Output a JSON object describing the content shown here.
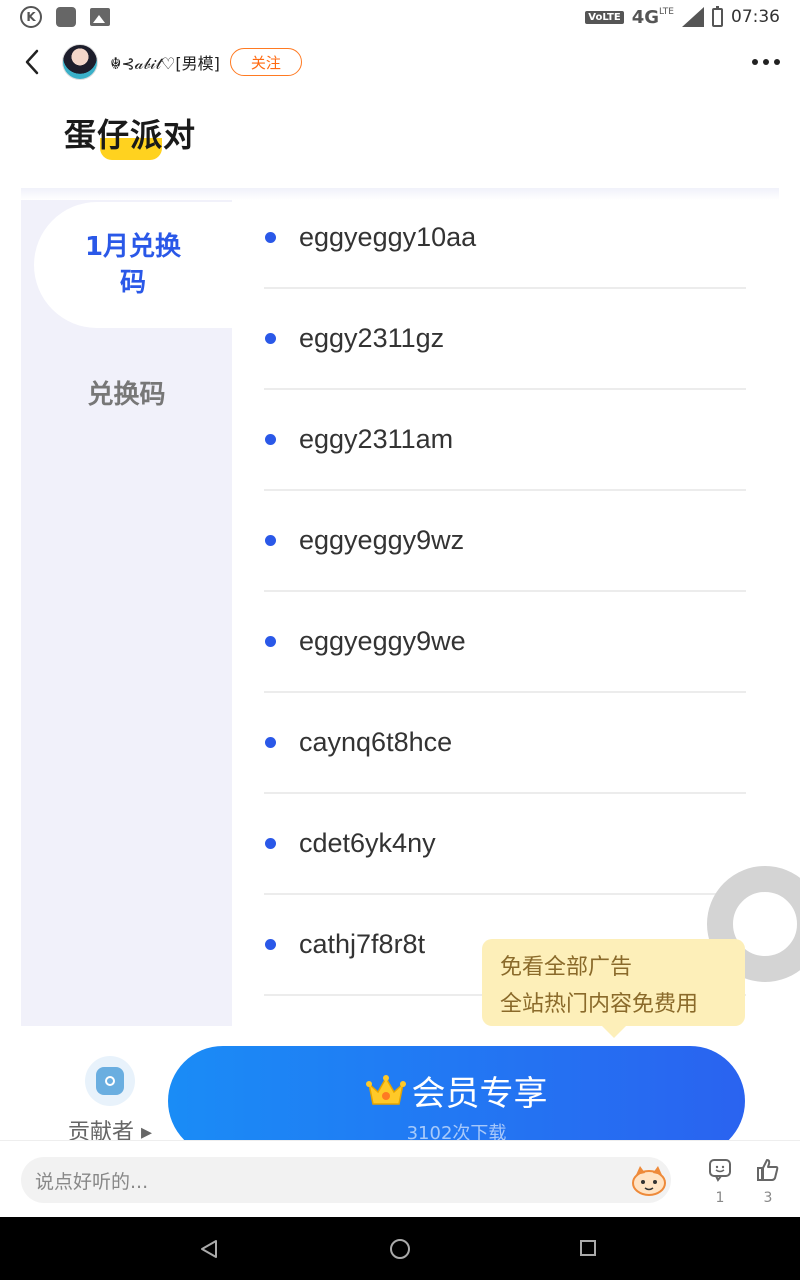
{
  "status_bar": {
    "network_volte": "VoLTE",
    "network_type": "4G",
    "network_lte": "LTE",
    "time": "07:36"
  },
  "header": {
    "username": "☬⊰𝒶𝒷𝒾𝓉♡[男模]",
    "follow_label": "关注"
  },
  "page": {
    "title": "蛋仔派对"
  },
  "sidebar": {
    "tabs": [
      {
        "label": "1月兑换码",
        "active": true
      },
      {
        "label": "兑换码",
        "active": false
      }
    ]
  },
  "codes": [
    "eggyeggy10aa",
    "eggy2311gz",
    "eggy2311am",
    "eggyeggy9wz",
    "eggyeggy9we",
    "caynq6t8hce",
    "cdet6yk4ny",
    "cathj7f8r8t"
  ],
  "tooltip": {
    "line1": "免看全部广告",
    "line2": "全站热门内容免费用"
  },
  "contributor": {
    "label": "贡献者 ▸"
  },
  "member_button": {
    "label": "会员专享",
    "downloads": "3102次下载"
  },
  "comment_bar": {
    "placeholder": "说点好听的...",
    "comment_count": "1",
    "like_count": "3"
  },
  "colors": {
    "accent_blue": "#2a58e8",
    "follow_orange": "#ff6a10",
    "highlight_yellow": "#ffd21f",
    "tooltip_bg": "#fdefb9"
  }
}
